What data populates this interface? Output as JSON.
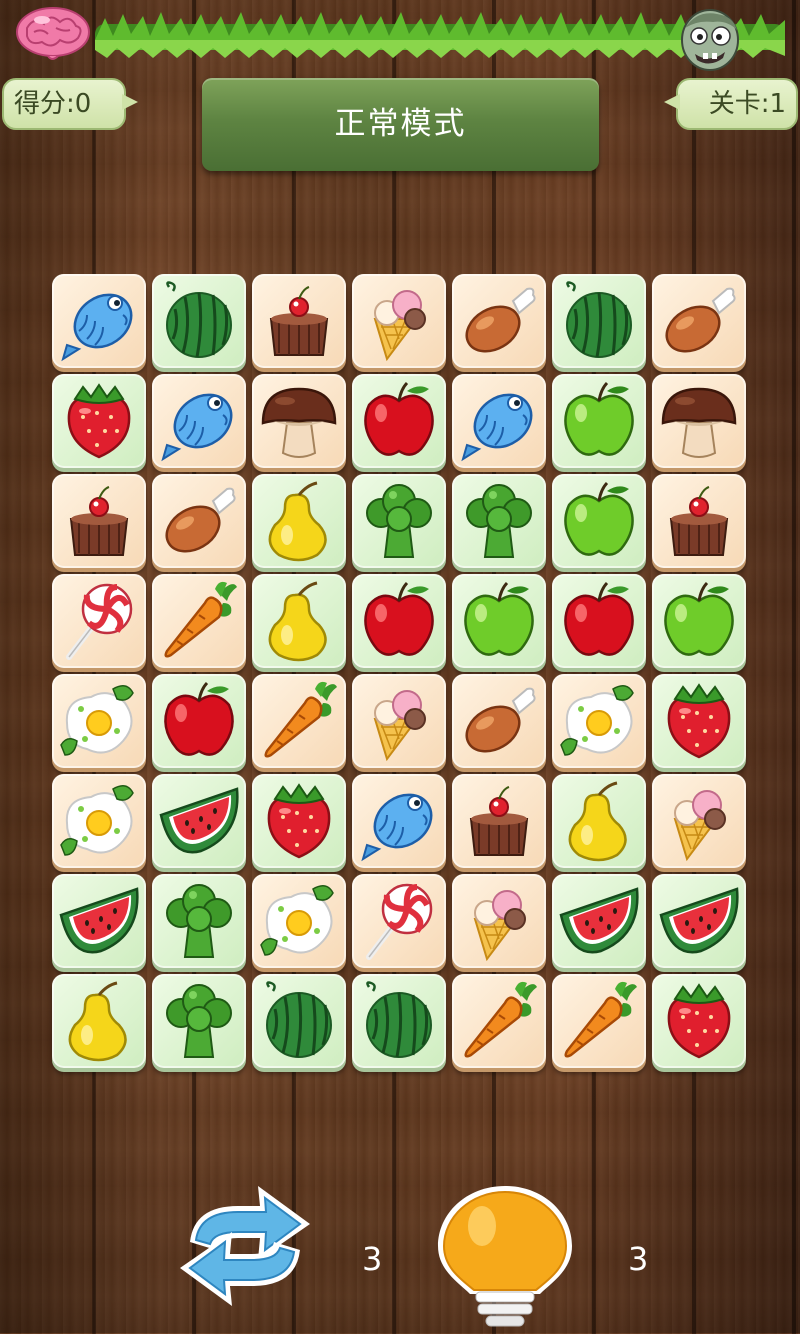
{
  "hud": {
    "score_label": "得分:0",
    "level_label": "关卡:1",
    "mode_title": "正常模式"
  },
  "tools": {
    "refresh_count": "3",
    "hint_count": "3"
  },
  "board": {
    "columns": 7,
    "rows": [
      [
        {
          "item": "fish",
          "bg": "peach"
        },
        {
          "item": "watermelon",
          "bg": "mint"
        },
        {
          "item": "cake",
          "bg": "peach"
        },
        {
          "item": "icecream",
          "bg": "peach"
        },
        {
          "item": "drumstick",
          "bg": "peach"
        },
        {
          "item": "watermelon",
          "bg": "mint"
        },
        {
          "item": "drumstick",
          "bg": "peach"
        }
      ],
      [
        {
          "item": "strawberry",
          "bg": "mint"
        },
        {
          "item": "fish",
          "bg": "peach"
        },
        {
          "item": "mushroom",
          "bg": "peach"
        },
        {
          "item": "apple",
          "bg": "mint"
        },
        {
          "item": "fish",
          "bg": "peach"
        },
        {
          "item": "greenapple",
          "bg": "mint"
        },
        {
          "item": "mushroom",
          "bg": "peach"
        }
      ],
      [
        {
          "item": "cake",
          "bg": "peach"
        },
        {
          "item": "drumstick",
          "bg": "peach"
        },
        {
          "item": "pear",
          "bg": "mint"
        },
        {
          "item": "broccoli",
          "bg": "mint"
        },
        {
          "item": "broccoli",
          "bg": "mint"
        },
        {
          "item": "greenapple",
          "bg": "mint"
        },
        {
          "item": "cake",
          "bg": "peach"
        }
      ],
      [
        {
          "item": "lollipop",
          "bg": "peach"
        },
        {
          "item": "carrot",
          "bg": "peach"
        },
        {
          "item": "pear",
          "bg": "mint"
        },
        {
          "item": "apple",
          "bg": "mint"
        },
        {
          "item": "greenapple",
          "bg": "mint"
        },
        {
          "item": "apple",
          "bg": "mint"
        },
        {
          "item": "greenapple",
          "bg": "mint"
        }
      ],
      [
        {
          "item": "egg",
          "bg": "peach"
        },
        {
          "item": "apple",
          "bg": "mint"
        },
        {
          "item": "carrot",
          "bg": "peach"
        },
        {
          "item": "icecream",
          "bg": "peach"
        },
        {
          "item": "drumstick",
          "bg": "peach"
        },
        {
          "item": "egg",
          "bg": "peach"
        },
        {
          "item": "strawberry",
          "bg": "mint"
        }
      ],
      [
        {
          "item": "egg",
          "bg": "peach"
        },
        {
          "item": "watermelonslice",
          "bg": "mint"
        },
        {
          "item": "strawberry",
          "bg": "mint"
        },
        {
          "item": "fish",
          "bg": "peach"
        },
        {
          "item": "cake",
          "bg": "peach"
        },
        {
          "item": "pear",
          "bg": "mint"
        },
        {
          "item": "icecream",
          "bg": "peach"
        }
      ],
      [
        {
          "item": "watermelonslice",
          "bg": "mint"
        },
        {
          "item": "broccoli",
          "bg": "mint"
        },
        {
          "item": "egg",
          "bg": "peach"
        },
        {
          "item": "lollipop",
          "bg": "peach"
        },
        {
          "item": "icecream",
          "bg": "peach"
        },
        {
          "item": "watermelonslice",
          "bg": "mint"
        },
        {
          "item": "watermelonslice",
          "bg": "mint"
        }
      ],
      [
        {
          "item": "pear",
          "bg": "mint"
        },
        {
          "item": "broccoli",
          "bg": "mint"
        },
        {
          "item": "watermelon",
          "bg": "mint"
        },
        {
          "item": "watermelon",
          "bg": "mint"
        },
        {
          "item": "carrot",
          "bg": "peach"
        },
        {
          "item": "carrot",
          "bg": "peach"
        },
        {
          "item": "strawberry",
          "bg": "mint"
        }
      ]
    ]
  },
  "icons": {
    "top_left": "brain-icon",
    "top_right": "zombie-head-icon",
    "refresh": "shuffle-arrows-icon",
    "hint": "lightbulb-icon"
  }
}
